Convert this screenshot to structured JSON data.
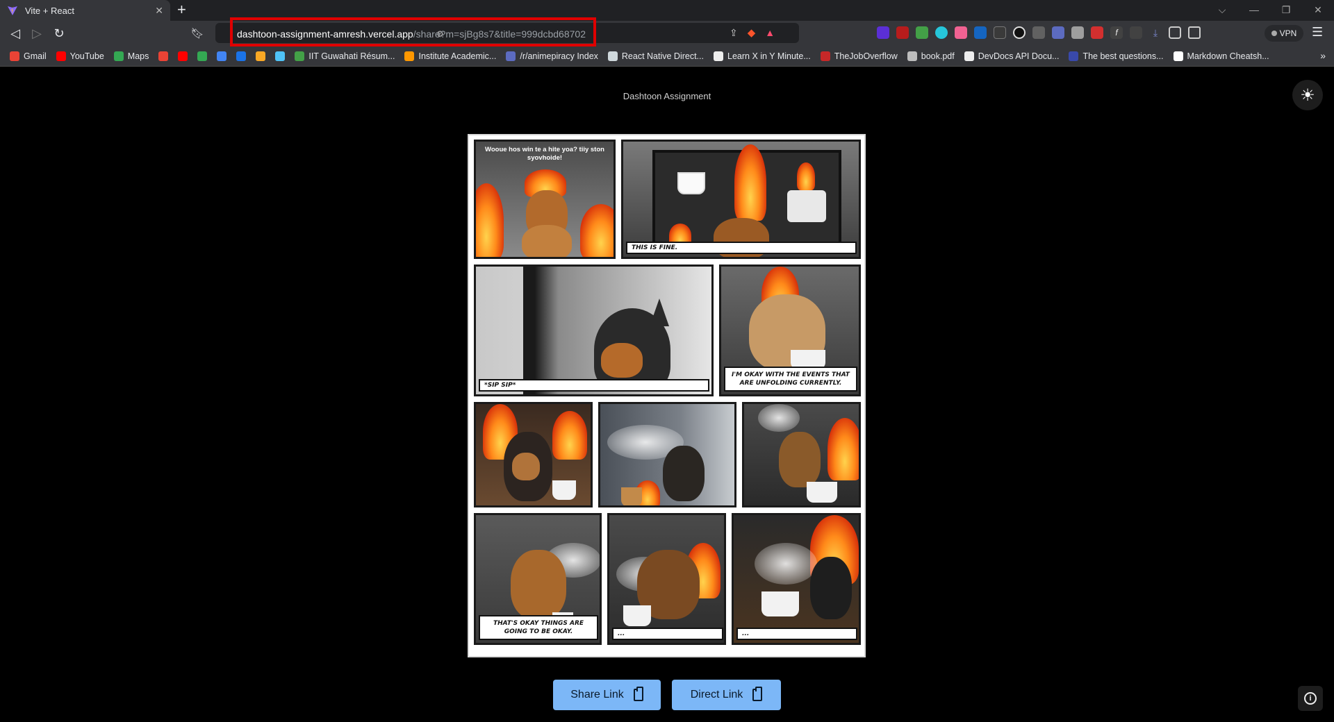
{
  "browser": {
    "tab_title": "Vite + React",
    "url_host": "dashtoon-assignment-amresh.vercel.app",
    "url_path": "/share?m=sjBg8s7&title=999dcbd68702",
    "vpn_label": "VPN",
    "bookmarks": [
      {
        "label": "Gmail",
        "color": "#ea4335"
      },
      {
        "label": "YouTube",
        "color": "#ff0000"
      },
      {
        "label": "Maps",
        "color": "#34a853"
      },
      {
        "label": "",
        "color": "#ea4335"
      },
      {
        "label": "",
        "color": "#ff0000"
      },
      {
        "label": "",
        "color": "#34a853"
      },
      {
        "label": "",
        "color": "#4285f4"
      },
      {
        "label": "",
        "color": "#1a73e8"
      },
      {
        "label": "",
        "color": "#f9a825"
      },
      {
        "label": "",
        "color": "#4fc3f7"
      },
      {
        "label": "IIT Guwahati Résum...",
        "color": "#43a047"
      },
      {
        "label": "Institute Academic...",
        "color": "#ff9800"
      },
      {
        "label": "/r/animepiracy Index",
        "color": "#5c6bc0"
      },
      {
        "label": "React Native Direct...",
        "color": "#cfd8dc"
      },
      {
        "label": "Learn X in Y Minute...",
        "color": "#eeeeee"
      },
      {
        "label": "TheJobOverflow",
        "color": "#c62828"
      },
      {
        "label": "book.pdf",
        "color": "#bdbdbd"
      },
      {
        "label": "DevDocs API Docu...",
        "color": "#eeeeee"
      },
      {
        "label": "The best questions...",
        "color": "#3949ab"
      },
      {
        "label": "Markdown Cheatsh...",
        "color": "#ffffff"
      }
    ]
  },
  "page": {
    "title": "Dashtoon Assignment",
    "share_button": "Share Link",
    "direct_button": "Direct Link"
  },
  "comic": {
    "panel1_bubble": "Wooue hos win te a hite yoa? tiiy ston syovhoide!",
    "panel2_caption": "This is fine.",
    "panel3_caption": "*sip sip*",
    "panel4_caption": "I'm okay with the events that are unfolding currently.",
    "panel8_caption": "That's okay things are going to be okay.",
    "panel9_caption": "...",
    "panel10_caption": "..."
  },
  "colors": {
    "accent_button": "#7cb7f7",
    "url_highlight": "#e00000"
  }
}
